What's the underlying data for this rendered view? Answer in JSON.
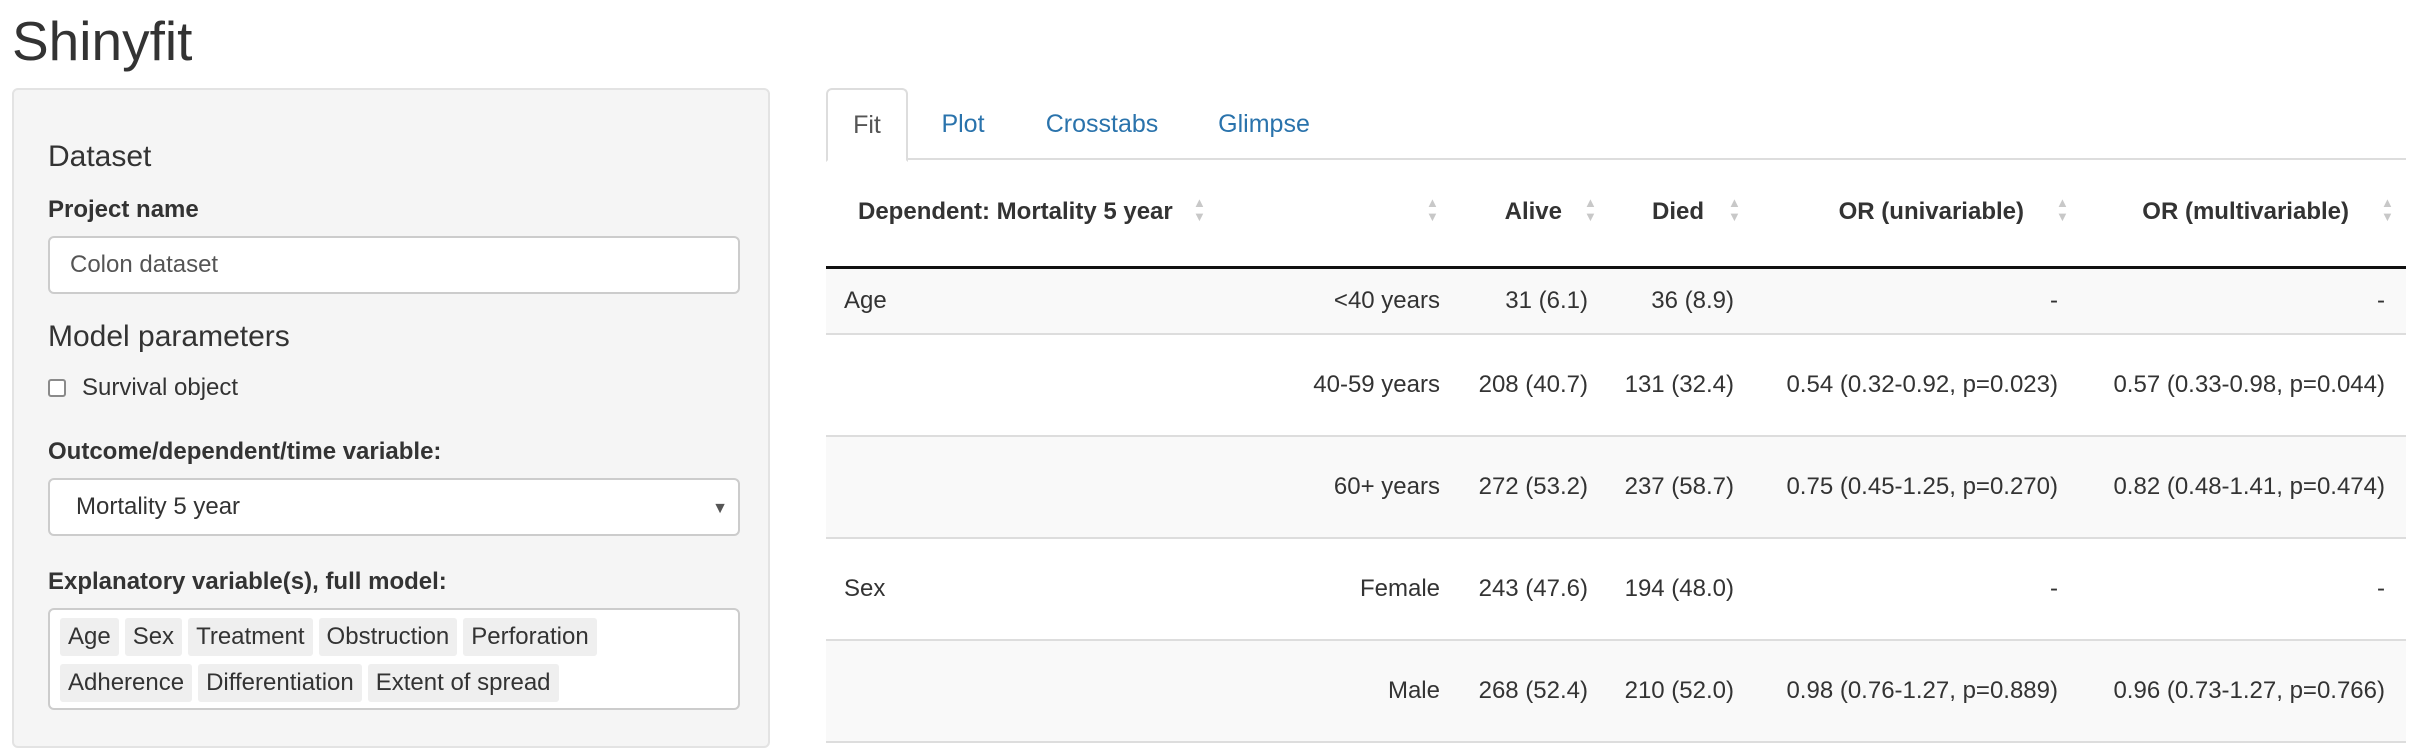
{
  "app": {
    "title": "Shinyfit"
  },
  "sidebar": {
    "dataset_heading": "Dataset",
    "project_label": "Project name",
    "project_value": "Colon dataset",
    "model_heading": "Model parameters",
    "survival_label": "Survival object",
    "survival_checked": false,
    "outcome_label": "Outcome/dependent/time variable:",
    "outcome_value": "Mortality 5 year",
    "explanatory_label": "Explanatory variable(s), full model:",
    "explanatory_values": [
      "Age",
      "Sex",
      "Treatment",
      "Obstruction",
      "Perforation",
      "Adherence",
      "Differentiation",
      "Extent of spread"
    ]
  },
  "tabs": [
    {
      "label": "Fit",
      "active": true
    },
    {
      "label": "Plot",
      "active": false
    },
    {
      "label": "Crosstabs",
      "active": false
    },
    {
      "label": "Glimpse",
      "active": false
    }
  ],
  "table": {
    "headers": [
      "Dependent: Mortality 5 year",
      "",
      "Alive",
      "Died",
      "OR (univariable)",
      "OR (multivariable)"
    ],
    "rows": [
      [
        "Age",
        "<40 years",
        "31 (6.1)",
        "36 (8.9)",
        "-",
        "-"
      ],
      [
        "",
        "40-59 years",
        "208 (40.7)",
        "131 (32.4)",
        "0.54 (0.32-0.92, p=0.023)",
        "0.57 (0.33-0.98, p=0.044)"
      ],
      [
        "",
        "60+ years",
        "272 (53.2)",
        "237 (58.7)",
        "0.75 (0.45-1.25, p=0.270)",
        "0.82 (0.48-1.41, p=0.474)"
      ],
      [
        "Sex",
        "Female",
        "243 (47.6)",
        "194 (48.0)",
        "-",
        "-"
      ],
      [
        "",
        "Male",
        "268 (52.4)",
        "210 (52.0)",
        "0.98 (0.76-1.27, p=0.889)",
        "0.96 (0.73-1.27, p=0.766)"
      ]
    ]
  },
  "icons": {
    "sort": "sort-arrows-icon",
    "caret": "caret-down-icon"
  },
  "colors": {
    "link": "#2a73ac",
    "panel": "#f5f5f5",
    "border": "#cccccc"
  }
}
